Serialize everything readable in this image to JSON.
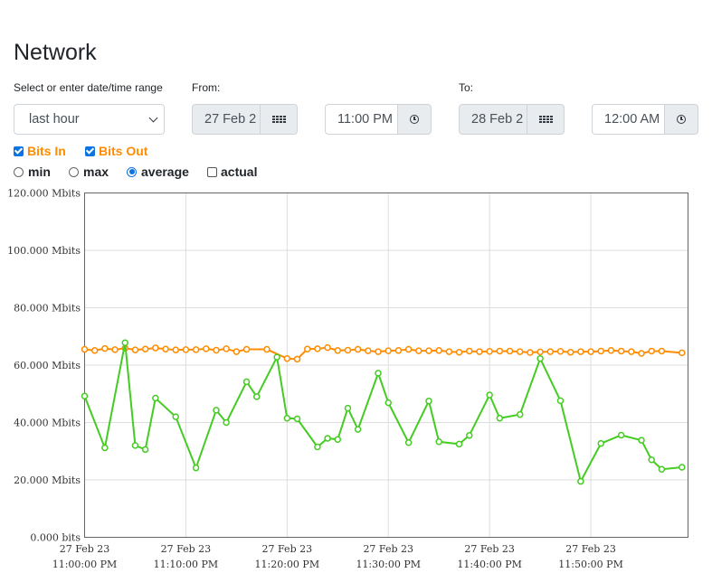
{
  "page": {
    "title": "Network"
  },
  "range": {
    "label": "Select or enter date/time range",
    "selected": "last hour",
    "from_label": "From:",
    "from_date": "27 Feb 2",
    "from_time": "11:00 PM",
    "to_label": "To:",
    "to_date": "28 Feb 2",
    "to_time": "12:00 AM"
  },
  "series_toggles": [
    {
      "label": "Bits In",
      "checked": true
    },
    {
      "label": "Bits Out",
      "checked": true
    }
  ],
  "aggregations": [
    {
      "label": "min",
      "type": "radio",
      "checked": false
    },
    {
      "label": "max",
      "type": "radio",
      "checked": false
    },
    {
      "label": "average",
      "type": "radio",
      "checked": true
    },
    {
      "label": "actual",
      "type": "checkbox",
      "checked": false
    }
  ],
  "colors": {
    "accent": "#0b74e0",
    "series_in": "#ff8c00",
    "series_out": "#44cc22",
    "grid": "#dddddd",
    "label": "#ff8c00"
  },
  "chart_data": {
    "type": "line",
    "x_labels": [
      [
        "27 Feb 23",
        "11:00:00 PM"
      ],
      [
        "27 Feb 23",
        "11:10:00 PM"
      ],
      [
        "27 Feb 23",
        "11:20:00 PM"
      ],
      [
        "27 Feb 23",
        "11:30:00 PM"
      ],
      [
        "27 Feb 23",
        "11:40:00 PM"
      ],
      [
        "27 Feb 23",
        "11:50:00 PM"
      ]
    ],
    "x_range_minutes": [
      0,
      59
    ],
    "y_ticks": [
      "0.000 bits",
      "20.000 Mbits",
      "40.000 Mbits",
      "60.000 Mbits",
      "80.000 Mbits",
      "100.000 Mbits",
      "120.000 Mbits"
    ],
    "ylim": [
      0,
      120
    ],
    "grid": true,
    "series": [
      {
        "name": "Bits In",
        "color": "#ff8c00",
        "values": [
          65.5,
          65.1,
          65.8,
          65.4,
          65.9,
          65.3,
          65.6,
          66.0,
          65.6,
          65.3,
          65.4,
          65.4,
          65.7,
          65.2,
          65.7,
          64.7,
          65.5,
          65.5,
          62.3,
          62.1,
          65.6,
          65.7,
          66.1,
          65.1,
          65.2,
          65.5,
          65.0,
          64.7,
          65.0,
          65.1,
          65.5,
          65.0,
          65.0,
          65.1,
          64.7,
          64.5,
          64.9,
          64.7,
          64.8,
          64.9,
          64.9,
          64.7,
          64.4,
          64.6,
          64.7,
          64.8,
          64.5,
          64.7,
          64.7,
          64.9,
          65.1,
          64.9,
          64.7,
          64.1,
          64.9,
          64.9,
          64.3
        ]
      },
      {
        "name": "Bits Out",
        "color": "#44cc22",
        "values": [
          49.2,
          31.2,
          67.8,
          32.0,
          30.6,
          48.5,
          42.0,
          24.2,
          44.3,
          40.0,
          54.2,
          49.0,
          62.8,
          41.5,
          41.3,
          31.5,
          34.5,
          34.1,
          45.0,
          37.6,
          57.2,
          46.9,
          33.0,
          47.5,
          33.3,
          32.5,
          35.5,
          49.6,
          41.5,
          42.8,
          62.3,
          47.6,
          19.5,
          32.7,
          35.6,
          33.8,
          27.0,
          23.7,
          24.4
        ]
      }
    ],
    "series_x_minutes": {
      "Bits In": [
        0,
        1,
        2,
        3,
        4,
        5,
        6,
        7,
        8,
        9,
        10,
        11,
        12,
        13,
        14,
        15,
        16,
        18,
        20,
        21,
        22,
        23,
        24,
        25,
        26,
        27,
        28,
        29,
        30,
        31,
        32,
        33,
        34,
        35,
        36,
        37,
        38,
        39,
        40,
        41,
        42,
        43,
        44,
        45,
        46,
        47,
        48,
        49,
        50,
        51,
        52,
        53,
        54,
        55,
        56,
        57,
        59
      ],
      "Bits Out": [
        0,
        2,
        4,
        5,
        6,
        7,
        9,
        11,
        13,
        14,
        16,
        17,
        19,
        20,
        21,
        23,
        24,
        25,
        26,
        27,
        29,
        30,
        32,
        34,
        35,
        37,
        38,
        40,
        41,
        43,
        45,
        47,
        49,
        51,
        53,
        55,
        56,
        57,
        59
      ]
    }
  }
}
